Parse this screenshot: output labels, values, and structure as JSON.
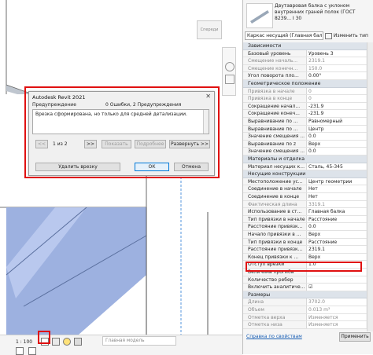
{
  "viewcube": {
    "label": "Спереди"
  },
  "dialog": {
    "title": "Autodesk Revit 2021",
    "col_warning": "Предупреждение",
    "counts": "0 Ошибки, 2 Предупреждения",
    "message": "Врезка сформирована, но только для средней детализации.",
    "nav_prev": "<<",
    "page": "1 из 2",
    "nav_next": ">>",
    "btn_show": "Показать",
    "btn_more": "Подробнее",
    "btn_expand": "Развернуть >>",
    "btn_delete": "Удалить врезку",
    "btn_ok": "ОК",
    "btn_cancel": "Отмена"
  },
  "statusbar": {
    "scale": "1 : 100",
    "model": "Главная модель"
  },
  "properties": {
    "type_name": "Двутавровая балка с уклоном внутренних граней полок (ГОСТ 8239... I 30",
    "selector": "Каркас несущий (Главная балк",
    "edit_type": "Изменить тип",
    "sections": {
      "constraints": "Зависимости",
      "geometry": "Геометрическое положение",
      "materials": "Материалы и отделка",
      "structural": "Несущие конструкции",
      "dimensions": "Размеры"
    },
    "rows_a": [
      {
        "label": "Базовый уровень",
        "value": "Уровень 3",
        "gray": false
      },
      {
        "label": "Смещение началь...",
        "value": "2319.1",
        "gray": true
      },
      {
        "label": "Смещение конечн...",
        "value": "150.0",
        "gray": true
      },
      {
        "label": "Угол поворота пло...",
        "value": "0.00°",
        "gray": false
      }
    ],
    "rows_b": [
      {
        "label": "Привязка в начале",
        "value": "0",
        "gray": true
      },
      {
        "label": "Привязка в конце",
        "value": "0",
        "gray": true
      },
      {
        "label": "Сокращение начал...",
        "value": "-231.9",
        "gray": false
      },
      {
        "label": "Сокращение конеч...",
        "value": "-231.9",
        "gray": false
      },
      {
        "label": "Выравнивание по ...",
        "value": "Равномерный",
        "gray": false
      },
      {
        "label": "Выравнивание по ...",
        "value": "Центр",
        "gray": false
      },
      {
        "label": "Значение смещения ...",
        "value": "0.0",
        "gray": false
      },
      {
        "label": "Выравнивание по z",
        "value": "Верх",
        "gray": false
      },
      {
        "label": "Значение смещения ...",
        "value": "0.0",
        "gray": false
      }
    ],
    "rows_c": [
      {
        "label": "Материал несущих к...",
        "value": "Сталь, 45-345",
        "gray": false
      }
    ],
    "rows_d": [
      {
        "label": "Местоположение ус...",
        "value": "Центр геометрии",
        "gray": false
      },
      {
        "label": "Соединение в начале",
        "value": "Нет",
        "gray": false
      },
      {
        "label": "Соединение в конце",
        "value": "Нет",
        "gray": false
      },
      {
        "label": "Фактическая длина",
        "value": "3319.1",
        "gray": true
      },
      {
        "label": "Использование в ст...",
        "value": "Главная балка",
        "gray": false
      },
      {
        "label": "Тип привязки в начале",
        "value": "Расстояние",
        "gray": false
      },
      {
        "label": "Расстояние привязк...",
        "value": "0.0",
        "gray": false
      },
      {
        "label": "Начало привязки в ...",
        "value": "Верх",
        "gray": false
      },
      {
        "label": "Тип привязки в конце",
        "value": "Расстояние",
        "gray": false
      },
      {
        "label": "Расстояние привязк...",
        "value": "2319.1",
        "gray": false
      },
      {
        "label": "Конец привязки к ...",
        "value": "Верх",
        "gray": false
      },
      {
        "label": "Отступ врезки",
        "value": "1.0",
        "gray": false
      },
      {
        "label": "Величина прогиба",
        "value": "",
        "gray": false
      },
      {
        "label": "Количество ребер",
        "value": "",
        "gray": false
      },
      {
        "label": "Включить аналитиче...",
        "value": "☑",
        "gray": false
      }
    ],
    "rows_e": [
      {
        "label": "Длина",
        "value": "3702.0",
        "gray": true
      },
      {
        "label": "Объем",
        "value": "0.013 m³",
        "gray": true
      },
      {
        "label": "Отметка верха",
        "value": "Изменяется",
        "gray": true
      },
      {
        "label": "Отметка низа",
        "value": "Изменяется",
        "gray": true
      }
    ],
    "help_link": "Справка по свойствам",
    "apply": "Применить"
  }
}
